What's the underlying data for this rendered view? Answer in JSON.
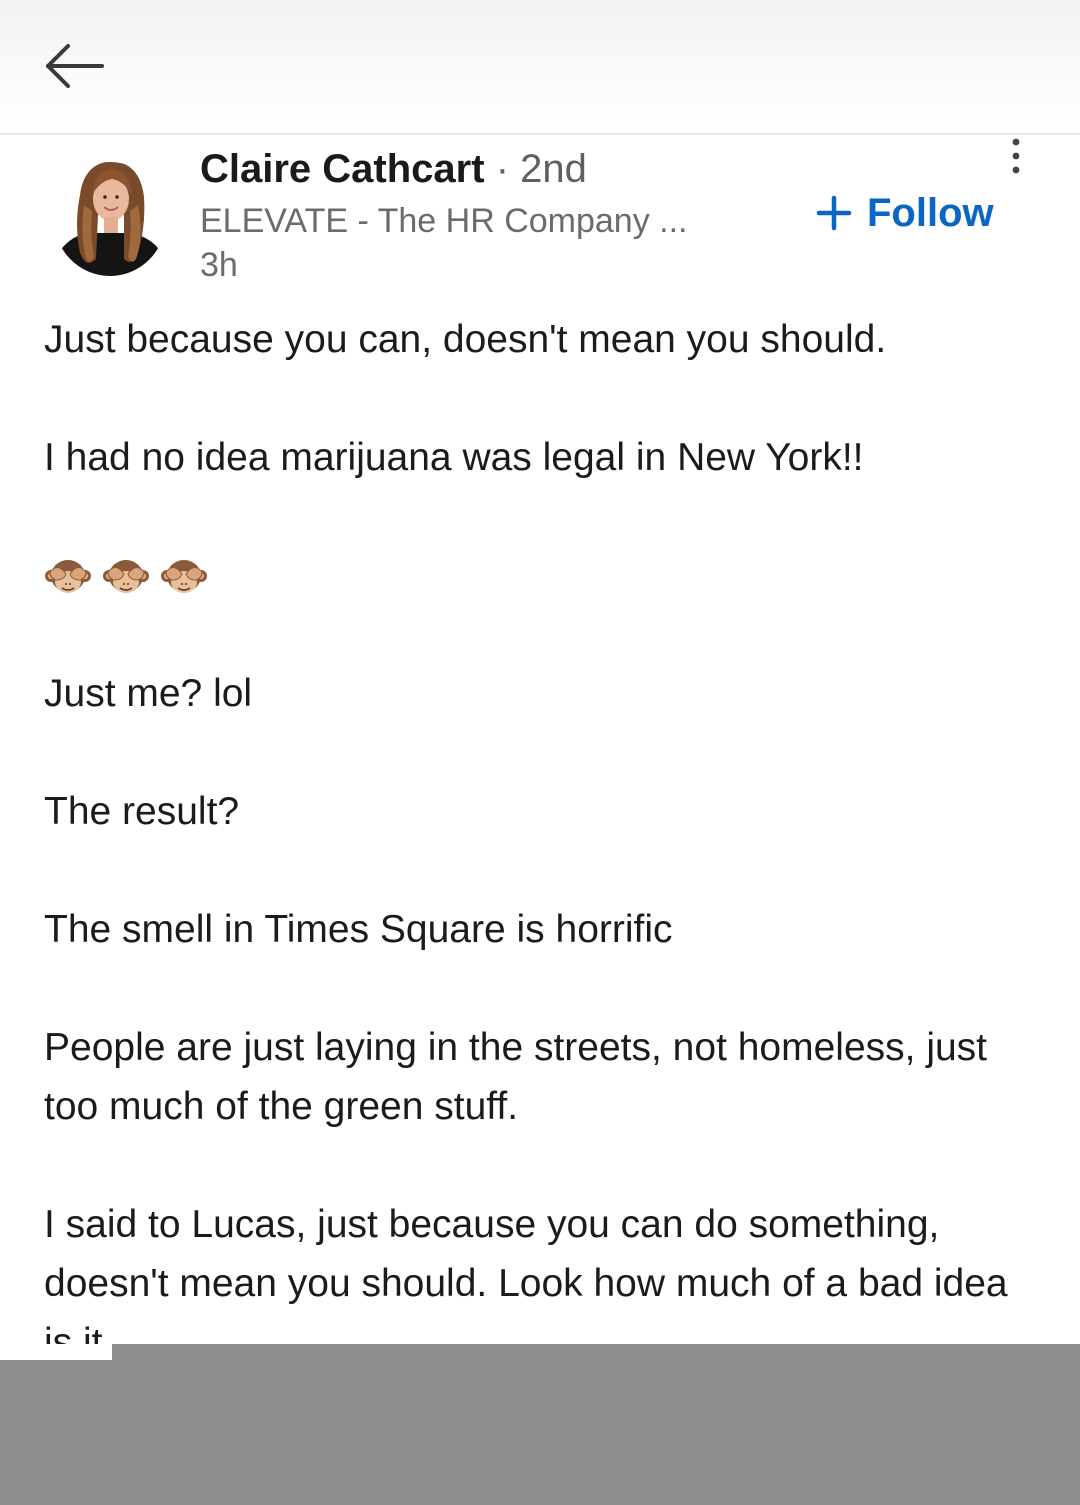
{
  "nav": {
    "back_icon": "arrow-left-icon"
  },
  "post": {
    "author": {
      "name": "Claire Cathcart",
      "separator": "·",
      "degree": "2nd",
      "headline": "ELEVATE - The HR Company ...",
      "time": "3h",
      "avatar_icon": "profile-photo"
    },
    "follow_label": "Follow",
    "more_icon": "vertical-ellipsis-icon",
    "paragraphs": [
      "Just because you can, doesn't mean you should.",
      "I had no idea marijuana was legal in New York!!"
    ],
    "emoji": [
      "see-no-evil-monkey",
      "see-no-evil-monkey",
      "see-no-evil-monkey"
    ],
    "paragraphs_after": [
      "Just me? lol",
      "The result?",
      "The smell in Times Square is horrific",
      "People are just laying in the streets, not homeless, just too much of the green stuff.",
      "I said to Lucas, just because you can do something, doesn't mean you should. Look how much of a bad idea is it"
    ]
  },
  "colors": {
    "accent": "#0a66c2",
    "overlay": "#8e8e8e"
  }
}
